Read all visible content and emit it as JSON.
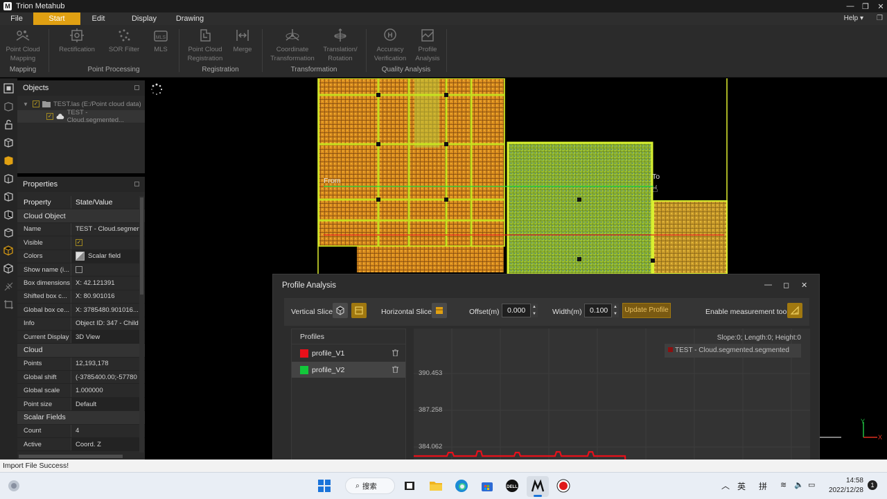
{
  "window": {
    "title": "Trion Metahub",
    "logo_letter": "M"
  },
  "menu": {
    "items": [
      "File",
      "Start",
      "Edit",
      "Display",
      "Drawing"
    ],
    "active": "Start",
    "help": "Help ▾"
  },
  "ribbon": {
    "buttons": [
      {
        "label": "Point Cloud\nMapping",
        "icon": "mapping-icon"
      },
      {
        "label": "Rectification",
        "icon": "rectification-icon"
      },
      {
        "label": "SOR Filter",
        "icon": "sor-filter-icon"
      },
      {
        "label": "MLS",
        "icon": "mls-icon"
      },
      {
        "label": "Point Cloud\nRegistration",
        "icon": "registration-icon"
      },
      {
        "label": "Merge",
        "icon": "merge-icon"
      },
      {
        "label": "Coordinate\nTransformation",
        "icon": "coordinate-icon"
      },
      {
        "label": "Translation/\nRotation",
        "icon": "translation-icon"
      },
      {
        "label": "Accuracy\nVerification",
        "icon": "accuracy-icon"
      },
      {
        "label": "Profile\nAnalysis",
        "icon": "profile-icon"
      }
    ],
    "groups": [
      "Mapping",
      "Point Processing",
      "Registration",
      "Transformation",
      "Quality Analysis"
    ]
  },
  "objects": {
    "title": "Objects",
    "tree": [
      {
        "label": "TEST.las (E:/Point cloud data)"
      },
      {
        "label": "TEST - Cloud.segmented..."
      }
    ]
  },
  "properties": {
    "title": "Properties",
    "header": {
      "key": "Property",
      "value": "State/Value"
    },
    "rows": [
      {
        "type": "section",
        "key": "Cloud Object"
      },
      {
        "key": "Name",
        "value": "TEST - Cloud.segment"
      },
      {
        "key": "Visible",
        "value": "",
        "check": true
      },
      {
        "key": "Colors",
        "value": "Scalar field",
        "box": true,
        "icon": "scalar-field-icon"
      },
      {
        "key": "Show name (i...",
        "value": "",
        "check": false
      },
      {
        "key": "Box dimensions",
        "value": "X: 42.121391"
      },
      {
        "key": "Shifted box c...",
        "value": "X: 80.901016"
      },
      {
        "key": "Global box ce...",
        "value": "X: 3785480.901016..."
      },
      {
        "key": "Info",
        "value": "Object ID: 347 - Child"
      },
      {
        "key": "Current Display",
        "value": "3D View",
        "box": true
      },
      {
        "type": "section",
        "key": "Cloud"
      },
      {
        "key": "Points",
        "value": "12,193,178"
      },
      {
        "key": "Global shift",
        "value": "(-3785400.00;-57780"
      },
      {
        "key": "Global scale",
        "value": "1.000000"
      },
      {
        "key": "Point size",
        "value": "Default",
        "box": true
      },
      {
        "type": "section",
        "key": "Scalar Fields"
      },
      {
        "key": "Count",
        "value": "4"
      },
      {
        "key": "Active",
        "value": "Coord. Z",
        "box": true
      }
    ]
  },
  "viewport": {
    "from_label": "From",
    "to_label": "To",
    "axis_y": "Y",
    "axis_x": "X"
  },
  "status": {
    "text": "Import File Success!"
  },
  "profile_dialog": {
    "title": "Profile Analysis",
    "vertical_slice": "Vertical Slice",
    "horizontal_slice": "Horizontal Slice",
    "offset_label": "Offset(m)",
    "offset_value": "0.000",
    "width_label": "Width(m)",
    "width_value": "0.100",
    "update_button": "Update Profile",
    "measure_label": "Enable measurement tool",
    "profiles_header": "Profiles",
    "profiles": [
      {
        "name": "profile_V1",
        "color": "#e8101a"
      },
      {
        "name": "profile_V2",
        "color": "#12c83a"
      }
    ],
    "chart_info": "Slope:0; Length:0; Height:0",
    "legend": "TEST - Cloud.segmented.segmented",
    "y_ticks": [
      "390.453",
      "387.258",
      "384.062"
    ]
  },
  "taskbar": {
    "search": "搜索",
    "ime1": "英",
    "ime2": "拼",
    "time": "14:58",
    "date": "2022/12/28",
    "notif": "1"
  },
  "colors": {
    "accent": "#e0a012",
    "profile_red": "#e8101a",
    "profile_green": "#12c83a"
  }
}
